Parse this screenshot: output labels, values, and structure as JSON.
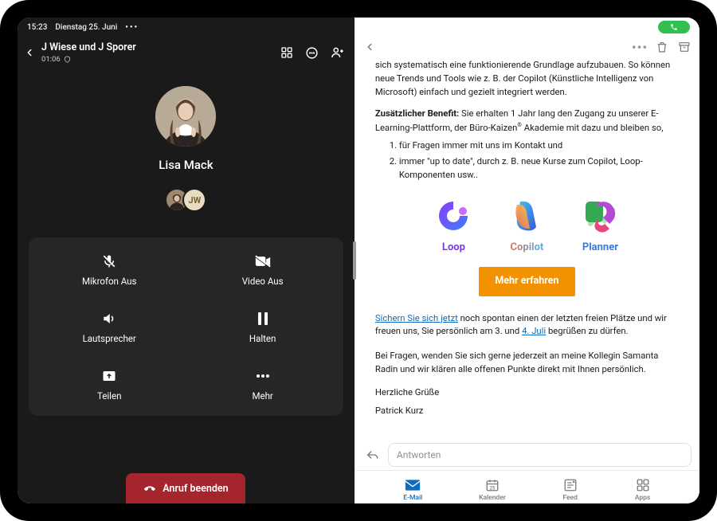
{
  "status": {
    "time": "15:23",
    "date": "Dienstag 25. Juni"
  },
  "call": {
    "title": "J Wiese und J Sporer",
    "duration": "01:06",
    "participant_name": "Lisa Mack",
    "sub_initials_2": "JW",
    "end_label": "Anruf beenden",
    "controls": {
      "mic": "Mikrofon Aus",
      "video": "Video Aus",
      "speaker": "Lautsprecher",
      "hold": "Halten",
      "share": "Teilen",
      "more": "Mehr"
    }
  },
  "mail": {
    "reply_placeholder": "Antworten",
    "cta": "Mehr erfahren",
    "p0": "sich systematisch eine funktionierende Grundlage aufzubauen. So können neue Trends und Tools wie z. B. der Copilot (Künstliche Intelligenz von Microsoft) einfach und gezielt integriert werden.",
    "benefit_label": "Zusätzlicher Benefit:",
    "benefit_text_a": " Sie erhalten 1 Jahr lang den Zugang zu unserer E-Learning-Plattform, der Büro-Kaizen",
    "benefit_text_b": " Akademie mit dazu und bleiben so,",
    "li1": "für Fragen immer mit uns im Kontakt und",
    "li2": "immer \"up to date\", durch z. B. neue Kurse zum Copilot, Loop-Komponenten usw..",
    "apps": {
      "loop": "Loop",
      "copilot": "Copilot",
      "planner": "Planner"
    },
    "link1": "Sichern Sie sich jetzt",
    "p2a": " noch spontan einen der letzten freien Plätze und wir freuen uns, Sie persönlich am 3. und ",
    "link2": "4. Juli",
    "p2b": " begrüßen zu dürfen.",
    "p3": "Bei Fragen, wenden Sie sich gerne jederzeit an meine Kollegin Samanta Radin und wir klären alle offenen Punkte direkt mit Ihnen persönlich.",
    "closing": "Herzliche Grüße",
    "sender": "Patrick Kurz",
    "tabs": {
      "email": "E-Mail",
      "calendar": "Kalender",
      "feed": "Feed",
      "apps": "Apps"
    }
  }
}
